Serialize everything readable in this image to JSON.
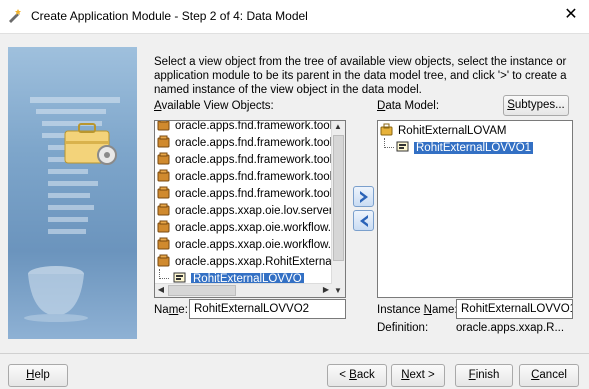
{
  "window": {
    "title": "Create Application Module - Step 2 of 4: Data Model",
    "close_glyph": "✕"
  },
  "instructions": "Select a view object from the tree of available view objects, select the instance or application module to be its parent in the data model tree, and click '>' to create a named instance of the view object in the data model.",
  "available": {
    "label": "Available View Objects:",
    "items": [
      "oracle.apps.fnd.framework.toolb",
      "oracle.apps.fnd.framework.toolb",
      "oracle.apps.fnd.framework.toolb",
      "oracle.apps.fnd.framework.toolb",
      "oracle.apps.fnd.framework.toolb",
      "oracle.apps.xxap.oie.lov.server",
      "oracle.apps.xxap.oie.workflow.a",
      "oracle.apps.xxap.oie.workflow.a",
      "oracle.apps.xxap.RohitExternall"
    ],
    "selected_child": "RohitExternalLOVVO"
  },
  "data_model": {
    "label": "Data Model:",
    "subtypes_button": "Subtypes...",
    "root": "RohitExternalLOVAM",
    "child": "RohitExternalLOVVO1"
  },
  "name": {
    "label": "Name:",
    "value": "RohitExternalLOVVO2"
  },
  "instance_name": {
    "label": "Instance Name:",
    "value": "RohitExternalLOVVO1"
  },
  "definition": {
    "label": "Definition:",
    "value": "oracle.apps.xxap.R..."
  },
  "buttons": {
    "help": "Help",
    "back": "< Back",
    "next": "Next >",
    "finish": "Finish",
    "cancel": "Cancel"
  },
  "colors": {
    "selection": "#3370c4",
    "shuttle_arrow": "#2a63b8"
  }
}
